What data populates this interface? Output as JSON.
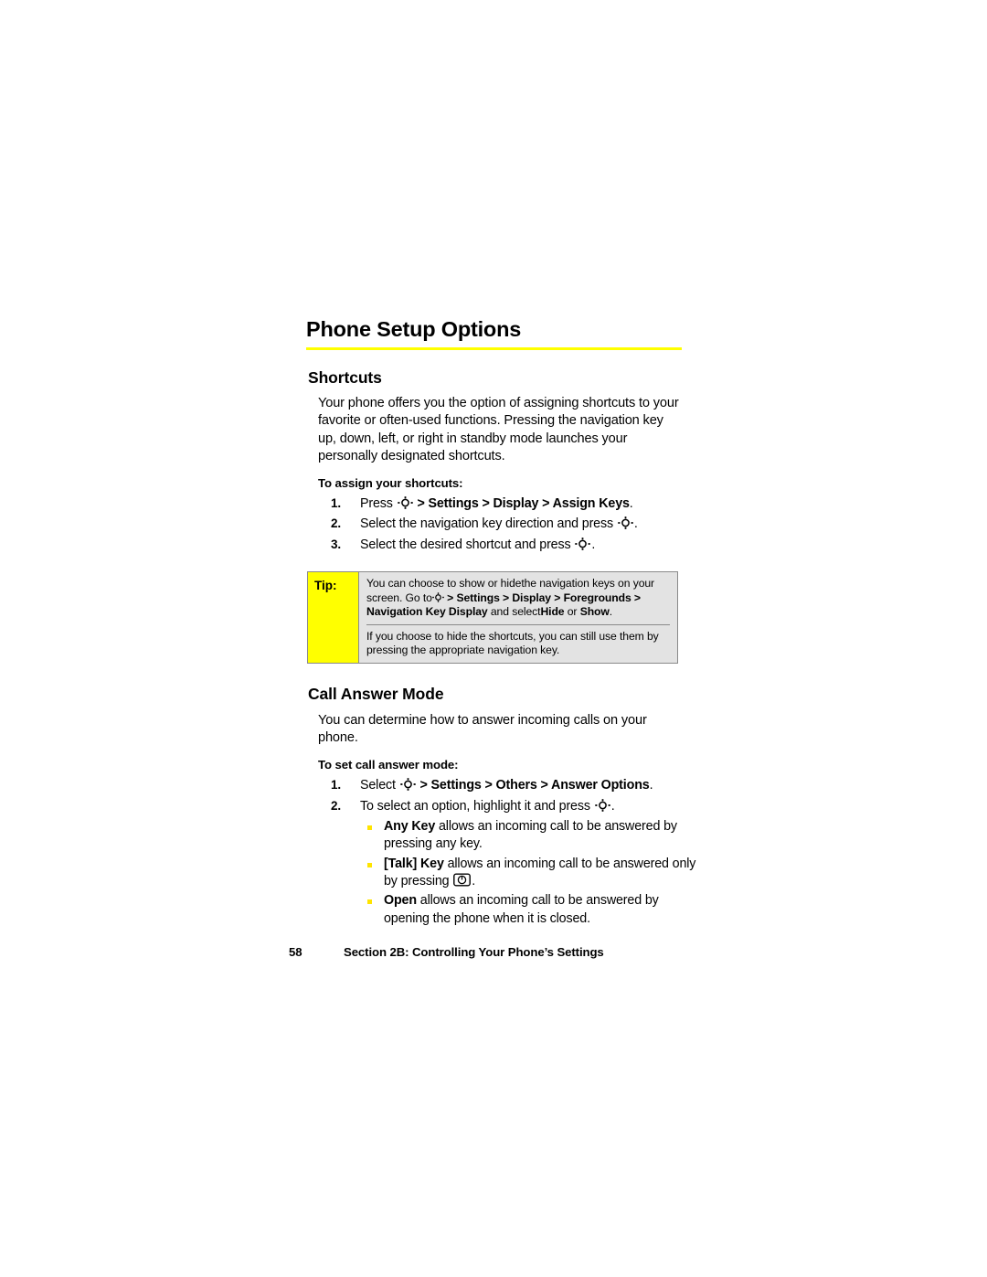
{
  "page": {
    "chapter_title": "Phone Setup Options",
    "rule_color": "#FFFF00"
  },
  "sections": [
    {
      "heading": "Shortcuts",
      "paragraph": "Your phone offers you the option of assigning shortcuts to your favorite or often-used functions. Pressing the navigation key up, down, left, or right in standby mode launches your personally designated shortcuts.",
      "lead_in": "To assign your shortcuts:",
      "steps": [
        {
          "num": "1.",
          "pre": "Press ",
          "icon": "navigation-key-icon",
          "bold": " > Settings > Display > Assign Keys",
          "post": "."
        },
        {
          "num": "2.",
          "pre": "Select the navigation key direction and press ",
          "icon": "navigation-key-icon",
          "bold": "",
          "post": "."
        },
        {
          "num": "3.",
          "pre": "Select the desired shortcut and press ",
          "icon": "navigation-key-icon",
          "bold": "",
          "post": "."
        }
      ]
    },
    {
      "heading": "Call Answer Mode",
      "paragraph": "You can determine how to answer incoming calls on your phone.",
      "lead_in": "To set call answer mode:",
      "steps": [
        {
          "num": "1.",
          "pre": "Select ",
          "icon": "navigation-key-icon",
          "bold": " > Settings > Others > Answer Options",
          "post": "."
        },
        {
          "num": "2.",
          "pre": "To select an option, highlight it and press ",
          "icon": "navigation-key-icon",
          "bold": "",
          "post": "."
        }
      ],
      "bullets": [
        {
          "bold": "Any Key",
          "text": " allows an incoming call to be answered by pressing any key."
        },
        {
          "bold": "[Talk] Key",
          "text": " allows an incoming call to be answered only by pressing ",
          "icon": "talk-key-icon",
          "post": "."
        },
        {
          "bold": "Open",
          "text": " allows an incoming call to be answered by opening the phone when it is closed."
        }
      ]
    }
  ],
  "tip": {
    "label": "Tip:",
    "para1_a": "You can choose to show or hide",
    "para1_b": "the navigation keys on your screen. Go to",
    "para1_icon": "navigation-key-icon",
    "para1_c": " > Settings > Display > Foregrounds > Navigation Key Display",
    "para1_d": " and select",
    "para1_e": "Hide",
    "para1_f": " or ",
    "para1_g": "Show",
    "para1_h": ".",
    "para2": "If you choose to hide the shortcuts, you can still use them by pressing the appropriate navigation key."
  },
  "footer": {
    "page_number": "58",
    "section_label": "Section 2B: Controlling Your Phone’s Settings"
  },
  "colors": {
    "accent_yellow": "#FFFF00",
    "bullet_yellow": "#FFE400",
    "tip_background": "#E3E3E3",
    "tip_border": "#8A8A8A"
  }
}
